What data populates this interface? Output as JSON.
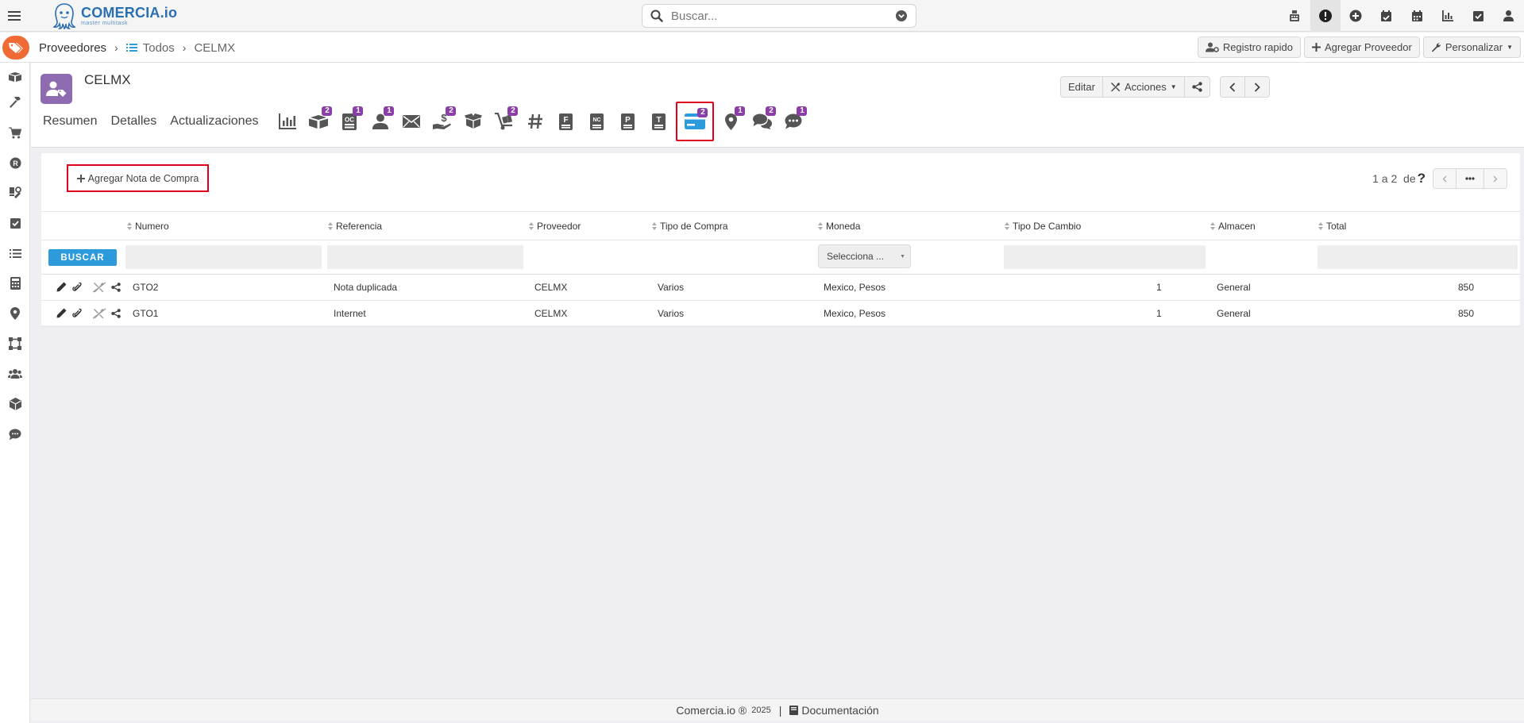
{
  "app": {
    "logo_name": "COMERCIA.io",
    "logo_tagline": "master multitask"
  },
  "search": {
    "placeholder": "Buscar..."
  },
  "breadcrumb": {
    "section": "Proveedores",
    "list": "Todos",
    "current": "CELMX"
  },
  "crumb_actions": {
    "quick_register": "Registro rapido",
    "add_provider": "Agregar Proveedor",
    "customize": "Personalizar"
  },
  "record": {
    "title": "CELMX",
    "edit_label": "Editar",
    "actions_label": "Acciones"
  },
  "tabs": {
    "summary": "Resumen",
    "details": "Detalles",
    "updates": "Actualizaciones"
  },
  "tab_badges": {
    "packages": "2",
    "oc": "1",
    "contacts": "1",
    "payments": "2",
    "cart": "2",
    "cards": "2",
    "locations": "1",
    "comments": "2",
    "messages": "1"
  },
  "tab_icon_labels": {
    "oc": "OC",
    "f": "F",
    "nc": "NC",
    "p": "P",
    "t": "T"
  },
  "panel": {
    "add_note_label": "Agregar Nota de Compra",
    "pager_text": "1 a 2  de",
    "help_mark": "?"
  },
  "table": {
    "headers": {
      "numero": "Numero",
      "referencia": "Referencia",
      "proveedor": "Proveedor",
      "tipo_compra": "Tipo de Compra",
      "moneda": "Moneda",
      "tipo_cambio": "Tipo De Cambio",
      "almacen": "Almacen",
      "total": "Total"
    },
    "search_button": "BUSCAR",
    "currency_filter": "Selecciona ...",
    "rows": [
      {
        "numero": "GTO2",
        "referencia": "Nota duplicada",
        "proveedor": "CELMX",
        "tipo_compra": "Varios",
        "moneda": "Mexico, Pesos",
        "tipo_cambio": "1",
        "almacen": "General",
        "total": "850"
      },
      {
        "numero": "GTO1",
        "referencia": "Internet",
        "proveedor": "CELMX",
        "tipo_compra": "Varios",
        "moneda": "Mexico, Pesos",
        "tipo_cambio": "1",
        "almacen": "General",
        "total": "850"
      }
    ]
  },
  "footer": {
    "brand": "Comercia.io ®",
    "year": "2025",
    "separator": "|",
    "docs": "Documentación"
  },
  "colors": {
    "brand_blue": "#2b6fb3",
    "tag_orange": "#f06a36",
    "avatar_purple": "#8e6bb1",
    "badge_purple": "#8b3ea8",
    "highlight_red": "#e0001b",
    "search_blue": "#2d9bdb"
  }
}
